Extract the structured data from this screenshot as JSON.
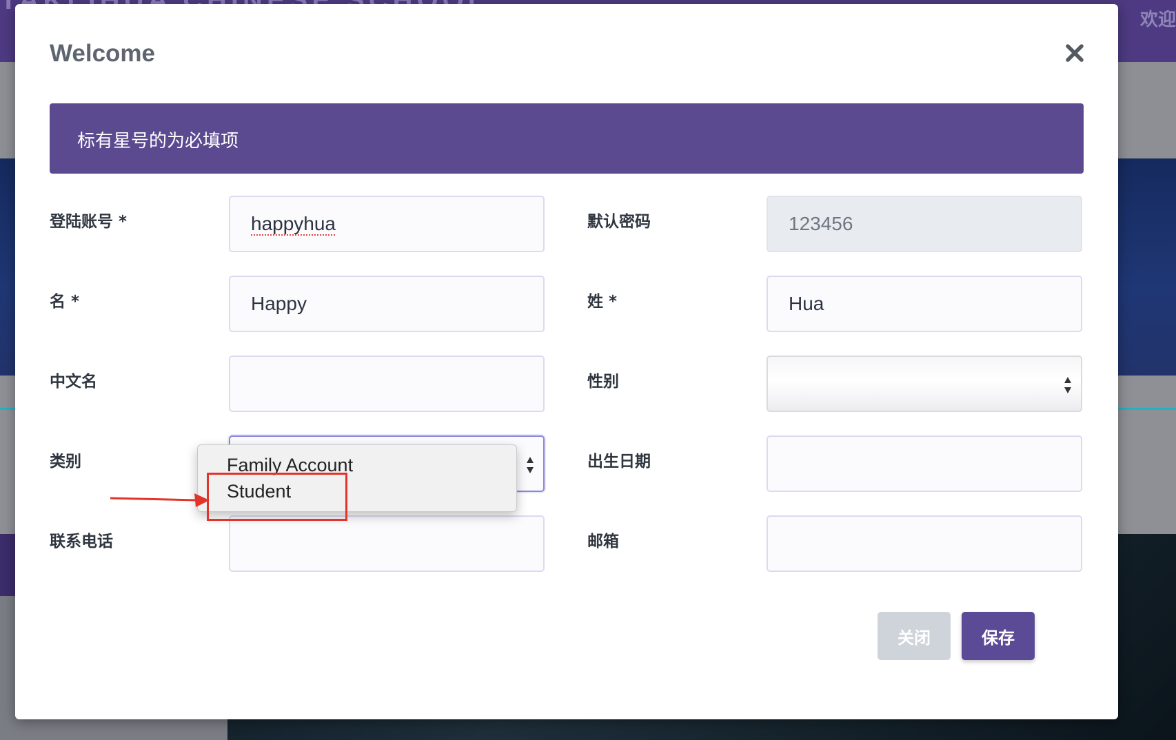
{
  "background": {
    "brand_text": "TAKLIHUA CHINESE SCHOOL",
    "welcome_text": "欢迎"
  },
  "modal": {
    "title": "Welcome",
    "close_icon": "close-icon",
    "notice": "标有星号的为必填项"
  },
  "form": {
    "login_account": {
      "label": "登陆账号 *",
      "value": "happyhua"
    },
    "default_password": {
      "label": "默认密码",
      "value": "123456"
    },
    "first_name": {
      "label": "名 *",
      "value": "Happy"
    },
    "last_name": {
      "label": "姓 *",
      "value": "Hua"
    },
    "chinese_name": {
      "label": "中文名",
      "value": ""
    },
    "gender": {
      "label": "性别",
      "value": ""
    },
    "category": {
      "label": "类别",
      "value": "",
      "options": [
        "Family Account",
        "Student"
      ]
    },
    "birth_date": {
      "label": "出生日期",
      "value": ""
    },
    "phone": {
      "label": "联系电话",
      "value": ""
    },
    "email": {
      "label": "邮箱",
      "value": ""
    }
  },
  "buttons": {
    "close_label": "关闭",
    "save_label": "保存"
  },
  "colors": {
    "primary": "#5c4a91",
    "annotation": "#e3342b"
  }
}
